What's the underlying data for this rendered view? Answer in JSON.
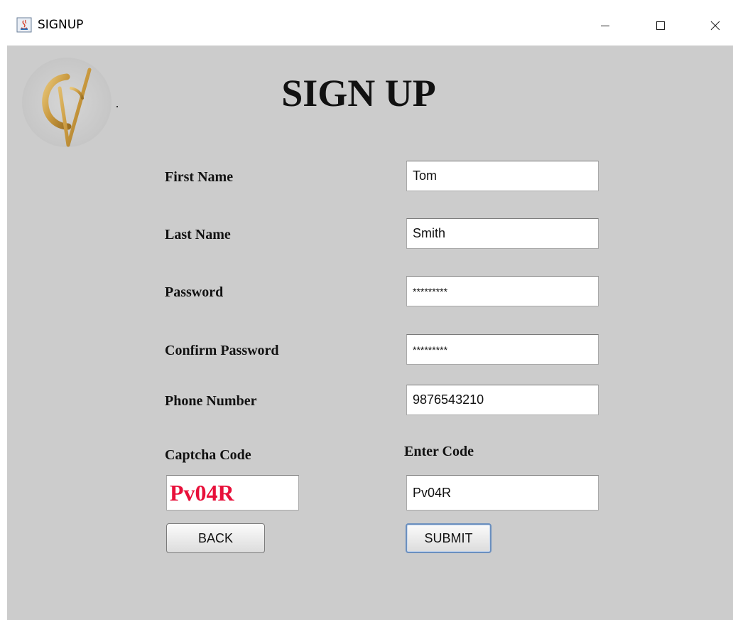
{
  "window": {
    "title": "SIGNUP",
    "controls": {
      "minimize_icon": "minimize-icon",
      "maximize_icon": "maximize-icon",
      "close_icon": "close-icon"
    }
  },
  "form": {
    "heading": "SIGN UP",
    "logo_icon": "cv-logo-icon",
    "fields": {
      "first_name": {
        "label": "First Name",
        "value": "Tom"
      },
      "last_name": {
        "label": "Last Name",
        "value": "Smith"
      },
      "password": {
        "label": "Password",
        "value": "*********"
      },
      "confirm_password": {
        "label": "Confirm Password",
        "value": "*********"
      },
      "phone_number": {
        "label": "Phone Number",
        "value": "9876543210"
      }
    },
    "captcha": {
      "label": "Captcha Code",
      "code": "Pv04R",
      "code_color": "#e8103a",
      "enter_label": "Enter Code",
      "entered_value": "Pv04R"
    },
    "buttons": {
      "back": "BACK",
      "submit": "SUBMIT"
    }
  },
  "colors": {
    "panel_background": "#cccccc",
    "title_bar": "#ffffff"
  }
}
